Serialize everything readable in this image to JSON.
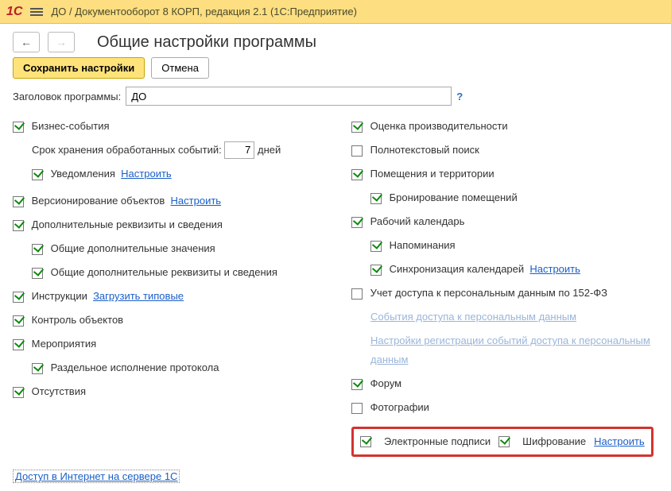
{
  "titlebar": {
    "logo_text": "1C",
    "title": "ДО / Документооборот 8 КОРП, редакция 2.1  (1С:Предприятие)"
  },
  "nav": {
    "back": "←",
    "forward": "→"
  },
  "page_title": "Общие настройки программы",
  "buttons": {
    "save": "Сохранить настройки",
    "cancel": "Отмена"
  },
  "title_field": {
    "label": "Заголовок программы:",
    "value": "ДО",
    "help": "?"
  },
  "left": {
    "business_events": "Бизнес-события",
    "retention_label": "Срок хранения обработанных событий:",
    "retention_value": "7",
    "retention_unit": "дней",
    "notifications": "Уведомления",
    "configure": "Настроить",
    "versioning": "Версионирование объектов",
    "extra_props": "Дополнительные реквизиты и сведения",
    "extra_values": "Общие дополнительные значения",
    "extra_all": "Общие дополнительные реквизиты и сведения",
    "instructions": "Инструкции",
    "load_typical": "Загрузить типовые",
    "object_control": "Контроль объектов",
    "activities": "Мероприятия",
    "split_protocol": "Раздельное исполнение протокола",
    "absences": "Отсутствия"
  },
  "right": {
    "perf_eval": "Оценка производительности",
    "fulltext": "Полнотекстовый поиск",
    "premises": "Помещения и территории",
    "booking": "Бронирование помещений",
    "calendar": "Рабочий календарь",
    "reminders": "Напоминания",
    "sync_cal": "Синхронизация календарей",
    "configure": "Настроить",
    "pd_access": "Учет доступа к персональным данным по 152-ФЗ",
    "pd_events": "События доступа к персональным данным",
    "pd_reg_settings": "Настройки регистрации событий доступа к персональным данным",
    "forum": "Форум",
    "photos": "Фотографии",
    "esig": "Электронные подписи",
    "encryption": "Шифрование",
    "esig_configure": "Настроить"
  },
  "footer": {
    "internet_access": "Доступ в Интернет на сервере 1С"
  }
}
